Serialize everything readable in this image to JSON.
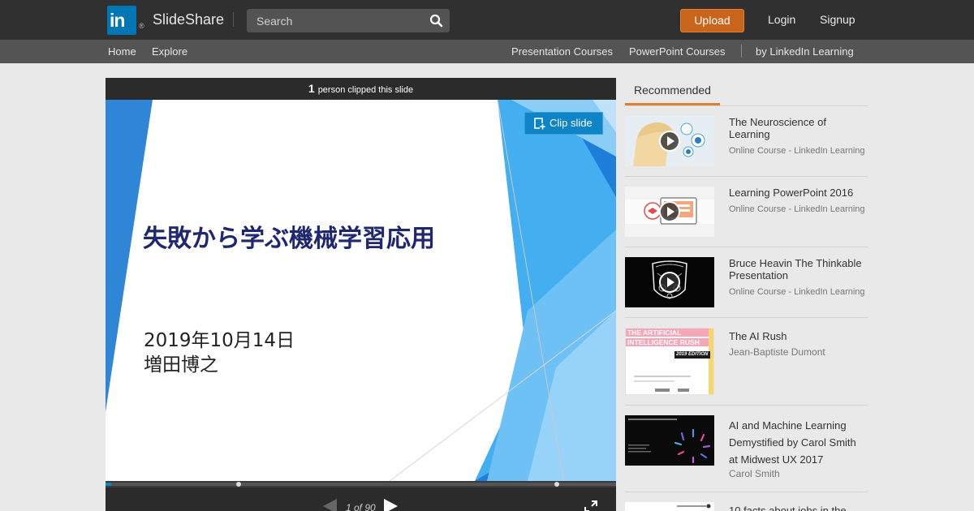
{
  "header": {
    "logo_mark": "in",
    "logo_reg": "®",
    "brand": "SlideShare",
    "search_placeholder": "Search",
    "upload_label": "Upload",
    "login_label": "Login",
    "signup_label": "Signup"
  },
  "subnav": {
    "home": "Home",
    "explore": "Explore",
    "presentation_courses": "Presentation Courses",
    "powerpoint_courses": "PowerPoint Courses",
    "by_linkedin": "by LinkedIn Learning"
  },
  "player": {
    "clip_count": "1",
    "clip_text": "person clipped this slide",
    "clip_slide_label": "Clip slide",
    "slide_title": "失敗から学ぶ機械学習応用",
    "slide_date": "2019年10月14日",
    "slide_author": "増田博之",
    "page_indicator": "1 of 90",
    "progress_fraction": 0.011,
    "colors": {
      "accent": "#0e83c5",
      "title": "#1f2770"
    }
  },
  "recommended": {
    "tab_label": "Recommended",
    "items": [
      {
        "title": "The Neuroscience of Learning",
        "subtitle": "Online Course - LinkedIn Learning",
        "video": true
      },
      {
        "title": "Learning PowerPoint 2016",
        "subtitle": "Online Course - LinkedIn Learning",
        "video": true
      },
      {
        "title": "Bruce Heavin The Thinkable Presentation",
        "subtitle": "Online Course - LinkedIn Learning",
        "video": true
      },
      {
        "title": "The AI Rush",
        "subtitle": "Jean-Baptiste Dumont",
        "video": false,
        "thumb_text_1": "THE ARTIFICIAL",
        "thumb_text_2": "INTELLIGENCE RUSH",
        "thumb_text_3": "2019 EDITION"
      },
      {
        "title": "AI and Machine Learning Demystified by Carol Smith at Midwest UX 2017",
        "subtitle": "Carol Smith",
        "video": false
      },
      {
        "title": "10 facts about jobs in the",
        "subtitle": "",
        "video": false
      }
    ]
  },
  "icons": [
    "linkedin-logo",
    "search-icon",
    "clip-icon",
    "prev-icon",
    "next-icon",
    "fullscreen-icon",
    "play-icon"
  ]
}
